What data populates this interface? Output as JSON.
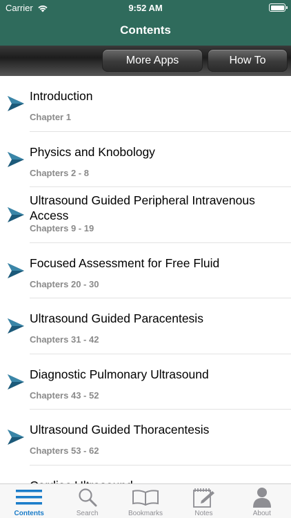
{
  "status": {
    "carrier": "Carrier",
    "time": "9:52 AM"
  },
  "nav": {
    "title": "Contents"
  },
  "toolbar": {
    "more_apps": "More Apps",
    "how_to": "How To"
  },
  "contents": [
    {
      "title": "Introduction",
      "subtitle": "Chapter 1"
    },
    {
      "title": "Physics and Knobology",
      "subtitle": "Chapters 2 - 8"
    },
    {
      "title": "Ultrasound Guided Peripheral Intravenous Access",
      "subtitle": "Chapters 9 - 19"
    },
    {
      "title": "Focused Assessment for Free Fluid",
      "subtitle": "Chapters 20 - 30"
    },
    {
      "title": "Ultrasound Guided Paracentesis",
      "subtitle": "Chapters 31 - 42"
    },
    {
      "title": "Diagnostic Pulmonary Ultrasound",
      "subtitle": "Chapters 43 - 52"
    },
    {
      "title": "Ultrasound Guided Thoracentesis",
      "subtitle": "Chapters 53 - 62"
    },
    {
      "title": "Cardiac Ultrasound",
      "subtitle": ""
    }
  ],
  "tabs": [
    {
      "label": "Contents",
      "icon": "list-icon",
      "active": true
    },
    {
      "label": "Search",
      "icon": "magnifier-icon",
      "active": false
    },
    {
      "label": "Bookmarks",
      "icon": "open-book-icon",
      "active": false
    },
    {
      "label": "Notes",
      "icon": "notepad-icon",
      "active": false
    },
    {
      "label": "About",
      "icon": "person-icon",
      "active": false
    }
  ],
  "colors": {
    "header": "#2f6b5c",
    "chevron": "#1c5a7a",
    "tab_active": "#1a7cc9"
  }
}
